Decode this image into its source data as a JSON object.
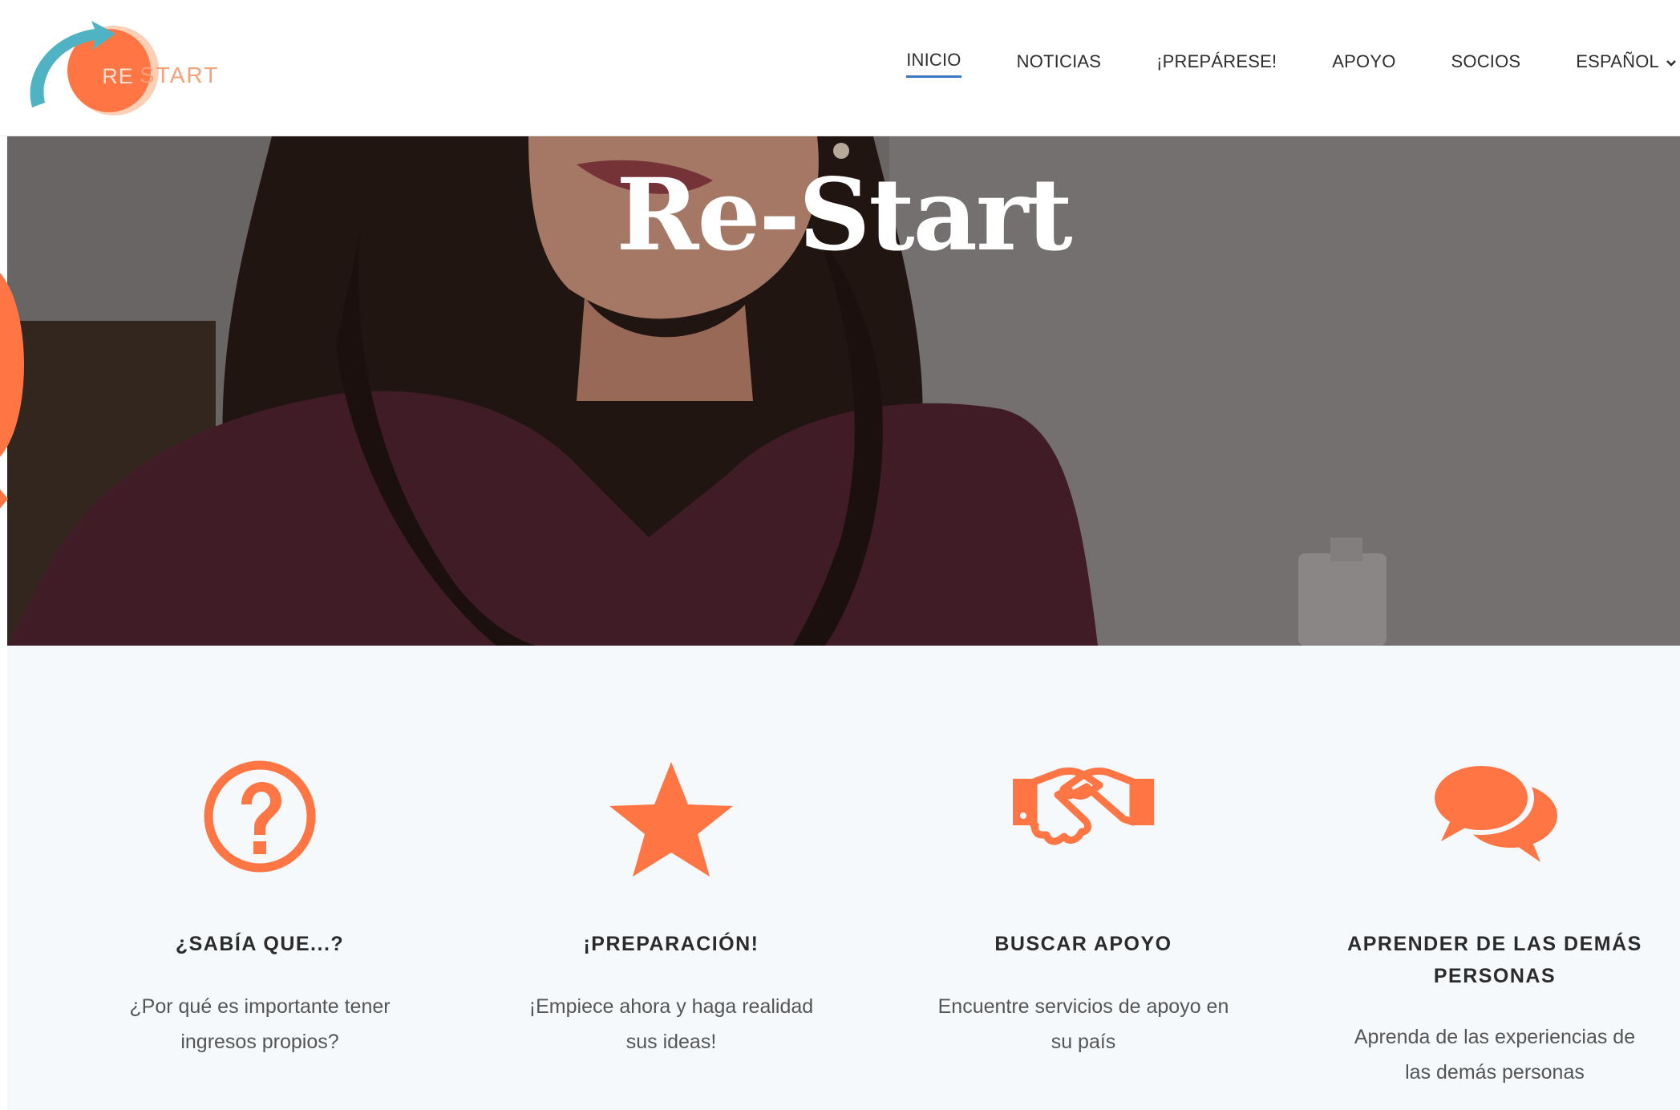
{
  "brand": {
    "logo_re": "RE",
    "logo_start": "START",
    "accent_color": "#ff7644",
    "arrow_color": "#4fb3c4"
  },
  "nav": {
    "items": [
      {
        "label": "INICIO",
        "active": true
      },
      {
        "label": "NOTICIAS",
        "active": false
      },
      {
        "label": "¡PREPÁRESE!",
        "active": false
      },
      {
        "label": "APOYO",
        "active": false
      },
      {
        "label": "SOCIOS",
        "active": false
      }
    ],
    "language": {
      "label": "ESPAÑOL",
      "icon": "chevron-down-icon"
    }
  },
  "hero": {
    "title": "Re-Start"
  },
  "features": [
    {
      "icon": "question-circle-icon",
      "title": "¿SABÍA QUE...?",
      "desc_line1": "¿Por qué es importante tener",
      "desc_line2": "ingresos propios?"
    },
    {
      "icon": "star-icon",
      "title": "¡PREPARACIÓN!",
      "desc_line1": "¡Empiece ahora y haga realidad",
      "desc_line2": "sus ideas!"
    },
    {
      "icon": "handshake-icon",
      "title": "BUSCAR APOYO",
      "desc_line1": "Encuentre servicios de apoyo en",
      "desc_line2": "su país"
    },
    {
      "icon": "chat-bubbles-icon",
      "title_line1": "APRENDER DE LAS DEMÁS",
      "title_line2": "PERSONAS",
      "desc_line1": "Aprenda de las experiencias de",
      "desc_line2": "las demás personas"
    }
  ]
}
